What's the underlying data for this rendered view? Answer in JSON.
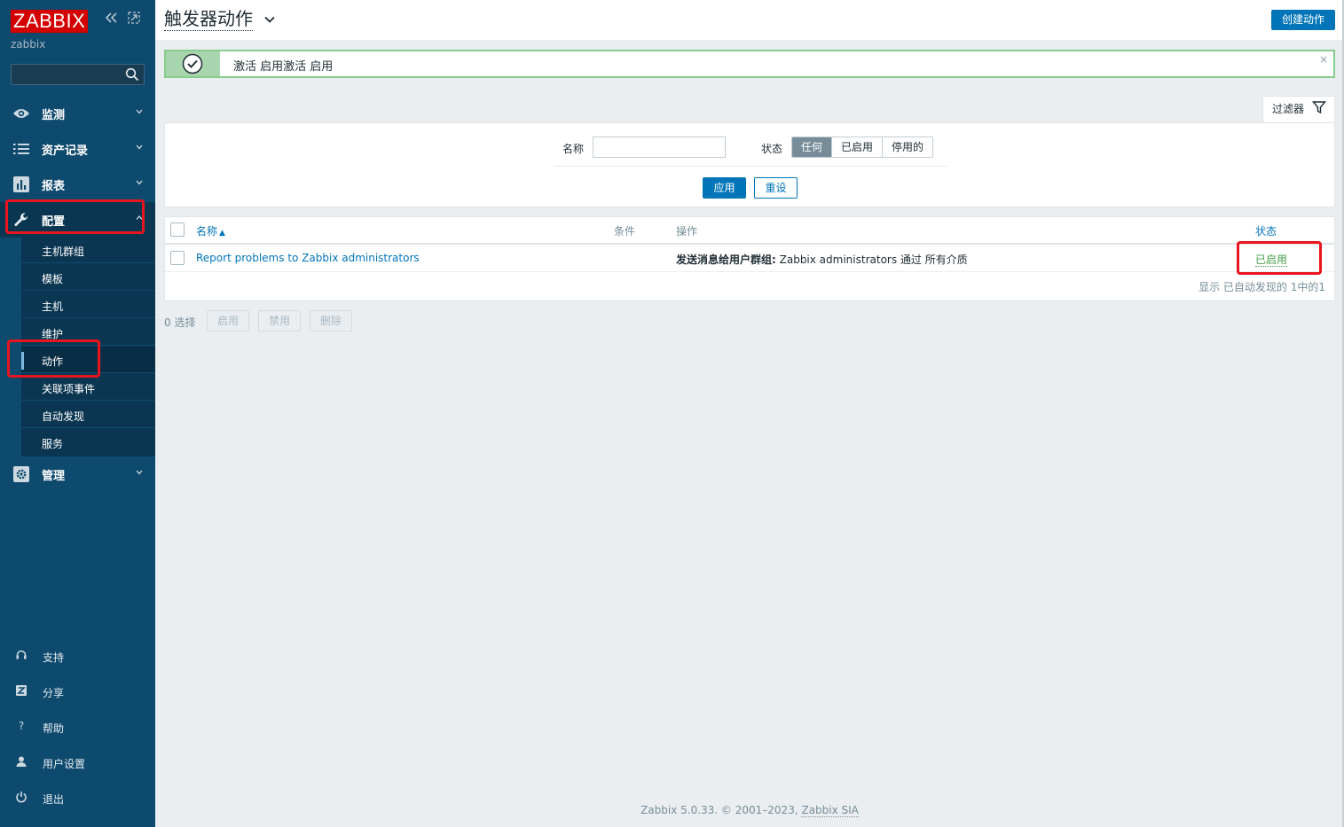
{
  "sidebar": {
    "logo": "ZABBIX",
    "server_name": "zabbix",
    "search_placeholder": "",
    "nav": [
      {
        "label": "监测",
        "icon": "eye-icon"
      },
      {
        "label": "资产记录",
        "icon": "list-icon"
      },
      {
        "label": "报表",
        "icon": "bar-chart-icon"
      },
      {
        "label": "配置",
        "icon": "wrench-icon"
      },
      {
        "label": "管理",
        "icon": "gear-icon"
      }
    ],
    "config_submenu": [
      "主机群组",
      "模板",
      "主机",
      "维护",
      "动作",
      "关联项事件",
      "自动发现",
      "服务"
    ],
    "active_submenu": "动作",
    "bottom": [
      {
        "label": "支持",
        "icon": "headset-icon"
      },
      {
        "label": "分享",
        "icon": "share-z-icon"
      },
      {
        "label": "帮助",
        "icon": "help-icon"
      },
      {
        "label": "用户设置",
        "icon": "user-icon"
      },
      {
        "label": "退出",
        "icon": "power-icon"
      }
    ]
  },
  "header": {
    "title": "触发器动作",
    "create_button": "创建动作"
  },
  "message": {
    "text": "激活 启用激活 启用",
    "close": "×"
  },
  "filter": {
    "tab_label": "过滤器",
    "name_label": "名称",
    "name_value": "",
    "status_label": "状态",
    "status_options": [
      "任何",
      "已启用",
      "停用的"
    ],
    "status_selected": "任何",
    "apply": "应用",
    "reset": "重设"
  },
  "table": {
    "columns": {
      "name": "名称",
      "sort_arrow": "▲",
      "conditions": "条件",
      "operations": "操作",
      "status": "状态"
    },
    "rows": [
      {
        "name": "Report problems to Zabbix administrators",
        "conditions": "",
        "operation_bold": "发送消息给用户群组:",
        "operation_rest": " Zabbix administrators 通过 所有介质",
        "status": "已启用"
      }
    ],
    "footer_info": "显示 已自动发现的 1中的1"
  },
  "mass_actions": {
    "selected": "0 选择",
    "enable": "启用",
    "disable": "禁用",
    "delete": "删除"
  },
  "footer": {
    "text": "Zabbix 5.0.33. © 2001–2023, ",
    "link": "Zabbix SIA"
  },
  "colors": {
    "sidebar_bg": "#0e4a6e",
    "accent": "#0275b8",
    "success": "#429e47",
    "highlight_box": "#e8151e"
  }
}
